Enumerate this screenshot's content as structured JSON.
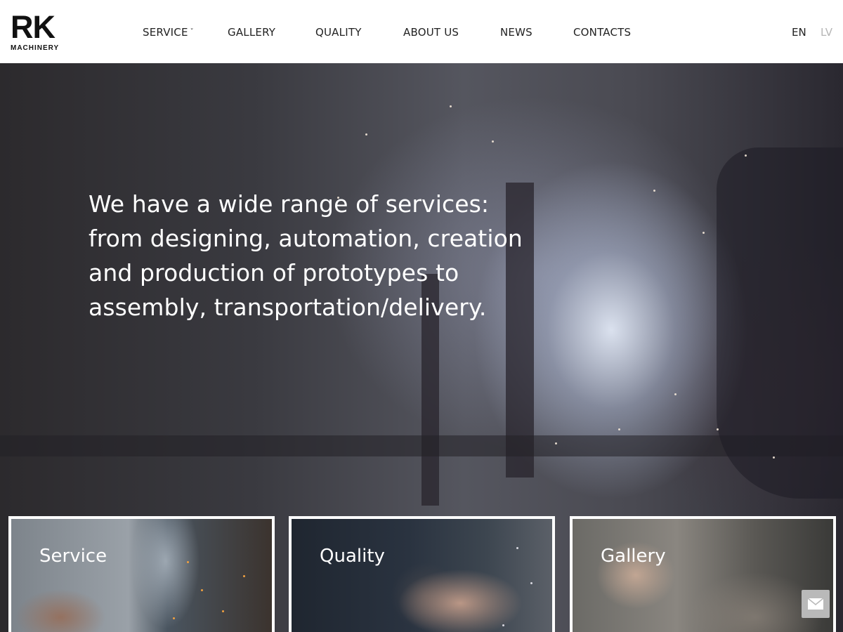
{
  "header": {
    "logo": {
      "main": "RK",
      "sub": "MACHINERY"
    },
    "nav": [
      {
        "label": "SERVICE",
        "has_dropdown": true
      },
      {
        "label": "GALLERY"
      },
      {
        "label": "QUALITY"
      },
      {
        "label": "ABOUT US"
      },
      {
        "label": "NEWS"
      },
      {
        "label": "CONTACTS"
      }
    ],
    "languages": {
      "active": "EN",
      "inactive": "LV"
    }
  },
  "hero": {
    "lines": [
      "We have a wide range of services:",
      "from designing, automation, creation",
      "and production of prototypes to",
      "assembly, transportation/delivery."
    ]
  },
  "cards": [
    {
      "title": "Service"
    },
    {
      "title": "Quality"
    },
    {
      "title": "Gallery"
    }
  ],
  "icons": {
    "dropdown": "chevron-down-icon",
    "contact": "mail-icon"
  },
  "colors": {
    "nav_text": "#222222",
    "lang_inactive": "#b5b5b5",
    "contact_button": "#b9b9b9"
  }
}
